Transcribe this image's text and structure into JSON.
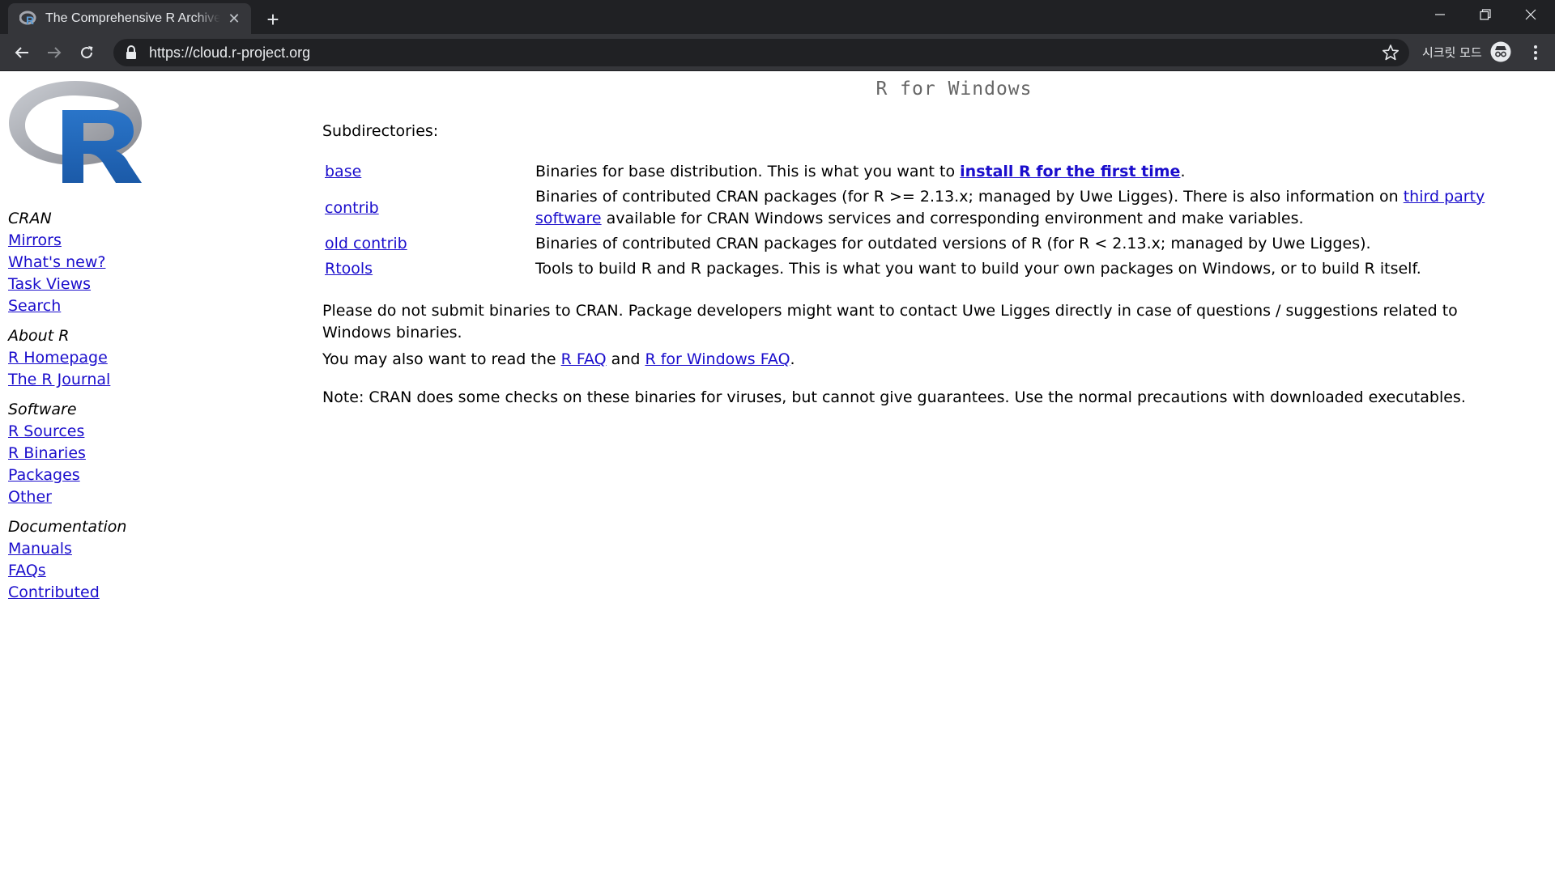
{
  "browser": {
    "tab_title": "The Comprehensive R Archive Network",
    "new_tab_symbol": "+",
    "close_symbol": "✕",
    "url": "https://cloud.r-project.org",
    "incognito_label": "시크릿 모드"
  },
  "sidebar": {
    "groups": [
      {
        "heading": "CRAN",
        "links": [
          "Mirrors",
          "What's new?",
          "Task Views",
          "Search"
        ]
      },
      {
        "heading": "About R",
        "links": [
          "R Homepage",
          "The R Journal"
        ]
      },
      {
        "heading": "Software",
        "links": [
          "R Sources",
          "R Binaries",
          "Packages",
          "Other"
        ]
      },
      {
        "heading": "Documentation",
        "links": [
          "Manuals",
          "FAQs",
          "Contributed"
        ]
      }
    ]
  },
  "main": {
    "title": "R for Windows",
    "subdirectories_label": "Subdirectories:",
    "rows": [
      {
        "name": "base",
        "desc_before": "Binaries for base distribution. This is what you want to ",
        "link": "install R for the first time",
        "desc_after": "."
      },
      {
        "name": "contrib",
        "desc_before": "Binaries of contributed CRAN packages (for R >= 2.13.x; managed by Uwe Ligges). There is also information on ",
        "link": "third party software",
        "desc_after": " available for CRAN Windows services and corresponding environment and make variables."
      },
      {
        "name": "old contrib",
        "desc_before": "Binaries of contributed CRAN packages for outdated versions of R (for R < 2.13.x; managed by Uwe Ligges).",
        "link": "",
        "desc_after": ""
      },
      {
        "name": "Rtools",
        "desc_before": "Tools to build R and R packages. This is what you want to build your own packages on Windows, or to build R itself.",
        "link": "",
        "desc_after": ""
      }
    ],
    "note_binaries": "Please do not submit binaries to CRAN. Package developers might want to contact Uwe Ligges directly in case of questions / suggestions related to Windows binaries.",
    "faq_before": "You may also want to read the ",
    "faq_link1": "R FAQ",
    "faq_mid": " and ",
    "faq_link2": "R for Windows FAQ",
    "faq_after": ".",
    "note_virus": "Note: CRAN does some checks on these binaries for viruses, but cannot give guarantees. Use the normal precautions with downloaded executables."
  },
  "colors": {
    "link": "#1a0dcc",
    "chrome_dark": "#202124",
    "chrome_tab": "#35363a",
    "r_logo_blue": "#2165b6",
    "r_logo_gray": "#a4a6ad"
  }
}
